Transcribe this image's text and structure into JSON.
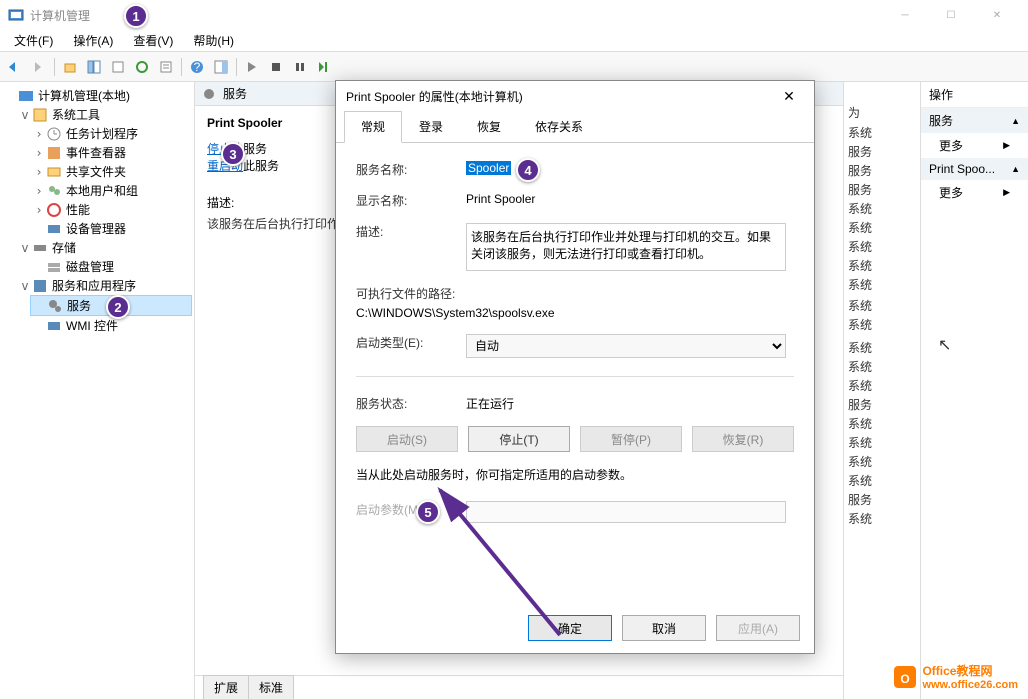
{
  "window": {
    "title": "计算机管理",
    "menus": [
      "文件(F)",
      "操作(A)",
      "查看(V)",
      "帮助(H)"
    ]
  },
  "tree": {
    "root": "计算机管理(本地)",
    "system_tools": "系统工具",
    "task_scheduler": "任务计划程序",
    "event_viewer": "事件查看器",
    "shared_folders": "共享文件夹",
    "local_users": "本地用户和组",
    "performance": "性能",
    "device_manager": "设备管理器",
    "storage": "存储",
    "disk_management": "磁盘管理",
    "services_apps": "服务和应用程序",
    "services": "服务",
    "wmi": "WMI 控件"
  },
  "mid": {
    "header": "服务",
    "service_name": "Print Spooler",
    "stop_label_prefix": "停止",
    "stop_label_suffix": "此服务",
    "restart_label_prefix": "重启动",
    "restart_label_suffix": "此服务",
    "desc_label": "描述:",
    "desc_text": "该服务在后台执行打印作业并处理与打印机的交互。如果关闭该服务，则无法进行打印或查看打印机。",
    "tab_extended": "扩展",
    "tab_standard": "标准"
  },
  "rcol": {
    "header": "为",
    "rows": [
      "系统",
      "服务",
      "服务",
      "服务",
      "系统",
      "系统",
      "系统",
      "系统",
      "系统",
      "",
      "系统",
      "系统",
      "",
      "",
      "系统",
      "系统",
      "系统",
      "服务",
      "系统",
      "系统",
      "系统",
      "系统",
      "服务",
      "系统"
    ]
  },
  "actions": {
    "header": "操作",
    "group1": "服务",
    "more1": "更多",
    "group2": "Print Spoo...",
    "more2": "更多"
  },
  "dialog": {
    "title": "Print Spooler 的属性(本地计算机)",
    "tabs": [
      "常规",
      "登录",
      "恢复",
      "依存关系"
    ],
    "service_name_label": "服务名称:",
    "service_name_value": "Spooler",
    "display_name_label": "显示名称:",
    "display_name_value": "Print Spooler",
    "desc_label": "描述:",
    "desc_value": "该服务在后台执行打印作业并处理与打印机的交互。如果关闭该服务，则无法进行打印或查看打印机。",
    "exe_path_label": "可执行文件的路径:",
    "exe_path_value": "C:\\WINDOWS\\System32\\spoolsv.exe",
    "startup_type_label": "启动类型(E):",
    "startup_type_value": "自动",
    "status_label": "服务状态:",
    "status_value": "正在运行",
    "btn_start": "启动(S)",
    "btn_stop": "停止(T)",
    "btn_pause": "暂停(P)",
    "btn_resume": "恢复(R)",
    "param_hint": "当从此处启动服务时，你可指定所适用的启动参数。",
    "start_params_label": "启动参数(M):",
    "start_params_value": "",
    "btn_ok": "确定",
    "btn_cancel": "取消",
    "btn_apply": "应用(A)"
  },
  "callouts": {
    "c1": "1",
    "c2": "2",
    "c3": "3",
    "c4": "4",
    "c5": "5"
  },
  "watermark": {
    "label1": "Office教程网",
    "label2": "www.office26.com"
  }
}
